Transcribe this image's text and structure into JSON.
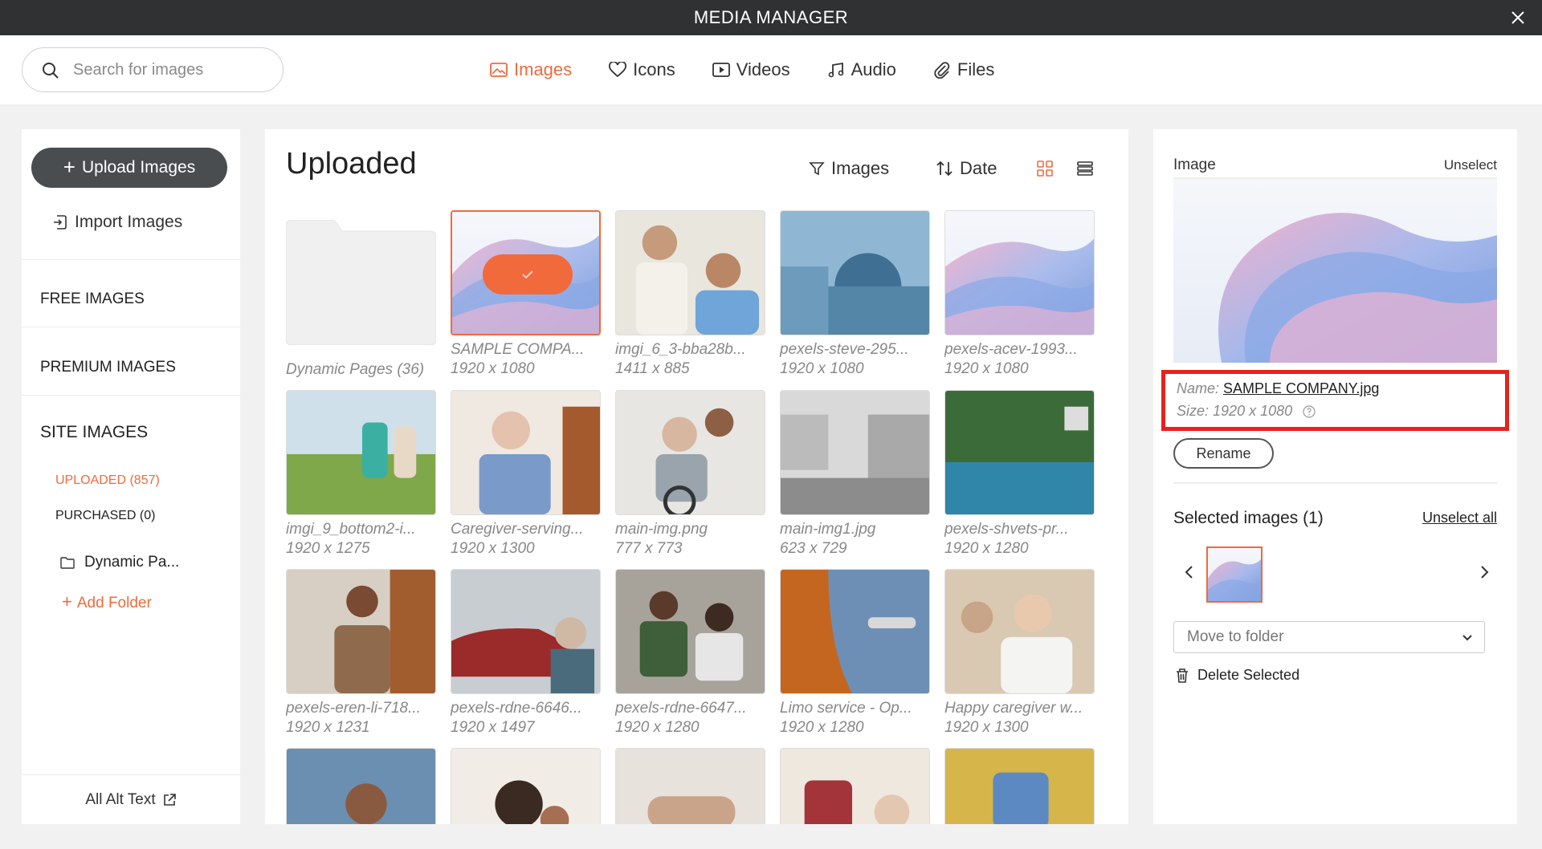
{
  "window": {
    "title": "MEDIA MANAGER"
  },
  "search": {
    "placeholder": "Search for images",
    "value": ""
  },
  "tabs": [
    {
      "label": "Images",
      "icon": "image-icon",
      "active": true
    },
    {
      "label": "Icons",
      "icon": "heart-icon",
      "active": false
    },
    {
      "label": "Videos",
      "icon": "video-icon",
      "active": false
    },
    {
      "label": "Audio",
      "icon": "music-note-icon",
      "active": false
    },
    {
      "label": "Files",
      "icon": "paperclip-icon",
      "active": false
    }
  ],
  "sidebar": {
    "upload_label": "Upload Images",
    "import_label": "Import Images",
    "free_images": "FREE IMAGES",
    "premium_images": "PREMIUM IMAGES",
    "site_images": "SITE IMAGES",
    "uploaded": "UPLOADED (857)",
    "purchased": "PURCHASED (0)",
    "folder": "Dynamic Pa...",
    "add_folder": "Add Folder",
    "footer": "All Alt Text"
  },
  "main": {
    "title": "Uploaded",
    "filter_label": "Images",
    "sort_label": "Date",
    "folder": {
      "caption": "Dynamic Pages (36)"
    },
    "items": [
      {
        "name": "SAMPLE COMPA...",
        "size": "1920 x 1080",
        "selected": true
      },
      {
        "name": "imgi_6_3-bba28b...",
        "size": "1411 x 885"
      },
      {
        "name": "pexels-steve-295...",
        "size": "1920 x 1080"
      },
      {
        "name": "pexels-acev-1993...",
        "size": "1920 x 1080"
      },
      {
        "name": "imgi_9_bottom2-i...",
        "size": "1920 x 1275"
      },
      {
        "name": "Caregiver-serving...",
        "size": "1920 x 1300"
      },
      {
        "name": "main-img.png",
        "size": "777 x 773"
      },
      {
        "name": "main-img1.jpg",
        "size": "623 x 729"
      },
      {
        "name": "pexels-shvets-pr...",
        "size": "1920 x 1280"
      },
      {
        "name": "pexels-eren-li-718...",
        "size": "1920 x 1231"
      },
      {
        "name": "pexels-rdne-6646...",
        "size": "1920 x 1497"
      },
      {
        "name": "pexels-rdne-6647...",
        "size": "1920 x 1280"
      },
      {
        "name": "Limo service - Op...",
        "size": "1920 x 1280"
      },
      {
        "name": "Happy caregiver w...",
        "size": "1920 x 1300"
      }
    ]
  },
  "details": {
    "section_label": "Image",
    "unselect": "Unselect",
    "name_label": "Name:",
    "name_value": "SAMPLE COMPANY.jpg",
    "size_label": "Size:",
    "size_value": "1920 x 1080",
    "rename": "Rename",
    "selected_title": "Selected images (1)",
    "unselect_all": "Unselect all",
    "move_placeholder": "Move to folder",
    "delete_selected": "Delete Selected"
  },
  "colors": {
    "accent": "#f06a3c",
    "titlebar": "#2f3133",
    "highlight_box": "#e8221b"
  }
}
